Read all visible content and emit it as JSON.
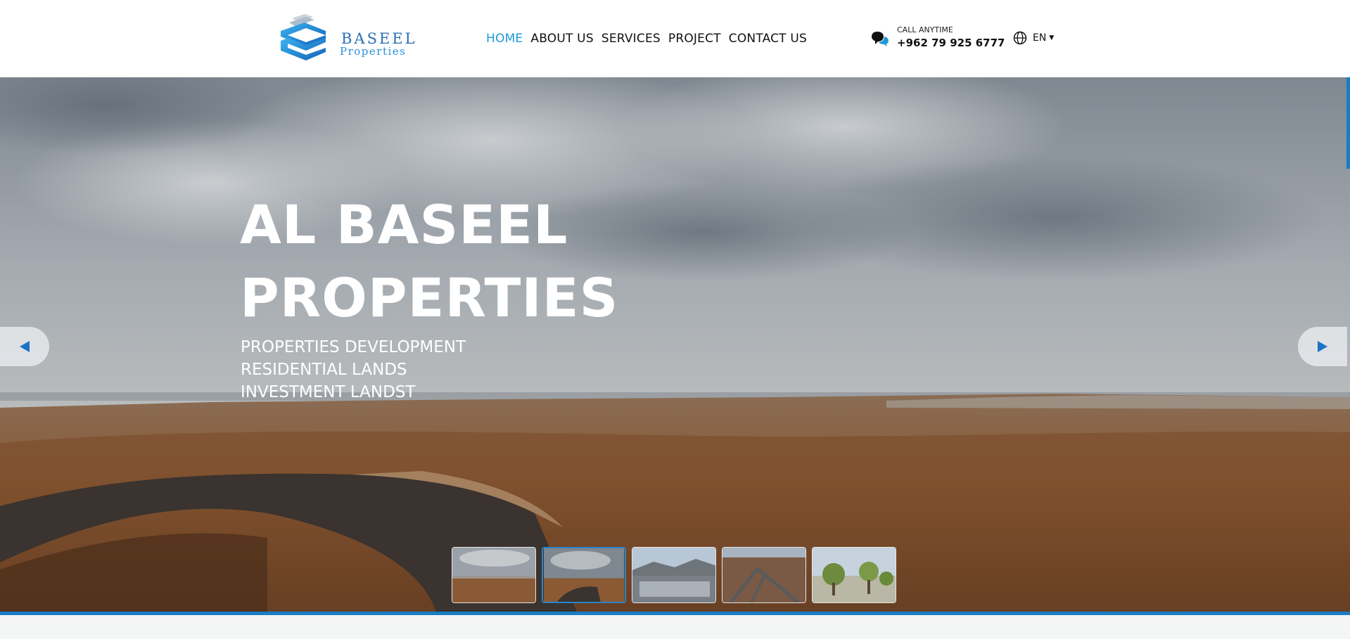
{
  "brand": {
    "name": "BASEEL",
    "sub": "Properties"
  },
  "nav": {
    "items": [
      {
        "label": "HOME",
        "active": true
      },
      {
        "label": "ABOUT US",
        "active": false
      },
      {
        "label": "SERVICES",
        "active": false
      },
      {
        "label": "PROJECT",
        "active": false
      },
      {
        "label": "CONTACT US",
        "active": false
      }
    ]
  },
  "contact": {
    "label": "CALL ANYTIME",
    "phone": "+962 79 925 6777",
    "icon": "chat-bubbles-icon"
  },
  "language": {
    "current": "EN",
    "icon": "globe-icon"
  },
  "hero": {
    "title_line1": "AL BASEEL",
    "title_line2": "PROPERTIES",
    "subtitles": [
      "PROPERTIES DEVELOPMENT",
      "RESIDENTIAL LANDS",
      "INVESTMENT LANDST"
    ],
    "prev_icon": "arrow-left-icon",
    "next_icon": "arrow-right-icon",
    "active_slide": 2,
    "slide_count": 5
  },
  "colors": {
    "accent": "#1e9ad6",
    "brand_blue": "#1a7dc4",
    "text": "#111111"
  }
}
